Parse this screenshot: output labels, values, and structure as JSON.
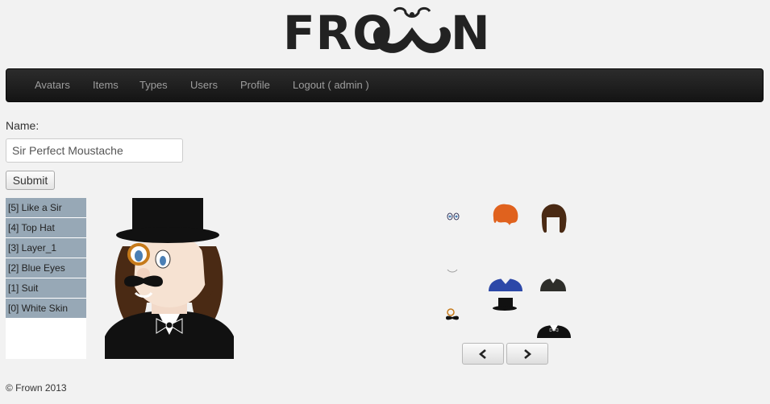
{
  "brand": {
    "left": "FRO",
    "right": "N",
    "logo_icon": "moustache-icon"
  },
  "nav": {
    "items": [
      {
        "label": "Avatars"
      },
      {
        "label": "Items"
      },
      {
        "label": "Types"
      },
      {
        "label": "Users"
      },
      {
        "label": "Profile"
      },
      {
        "label": "Logout ( admin )"
      }
    ]
  },
  "form": {
    "name_label": "Name:",
    "name_value": "Sir Perfect Moustache",
    "submit_label": "Submit"
  },
  "layers": [
    {
      "label": "[5] Like a Sir"
    },
    {
      "label": "[4] Top Hat"
    },
    {
      "label": "[3] Layer_1"
    },
    {
      "label": "[2] Blue Eyes"
    },
    {
      "label": "[1] Suit"
    },
    {
      "label": "[0] White Skin"
    }
  ],
  "item_grid": {
    "items": [
      "eyes",
      "orange-hair",
      "brown-curly-hair",
      "mouth",
      "blue-shirt",
      "dark-jacket",
      "monocle-moustache",
      "top-hat",
      "tuxedo"
    ]
  },
  "pager": {
    "prev_icon": "chevron-left-icon",
    "next_icon": "chevron-right-icon"
  },
  "footer": {
    "text": "© Frown 2013"
  }
}
